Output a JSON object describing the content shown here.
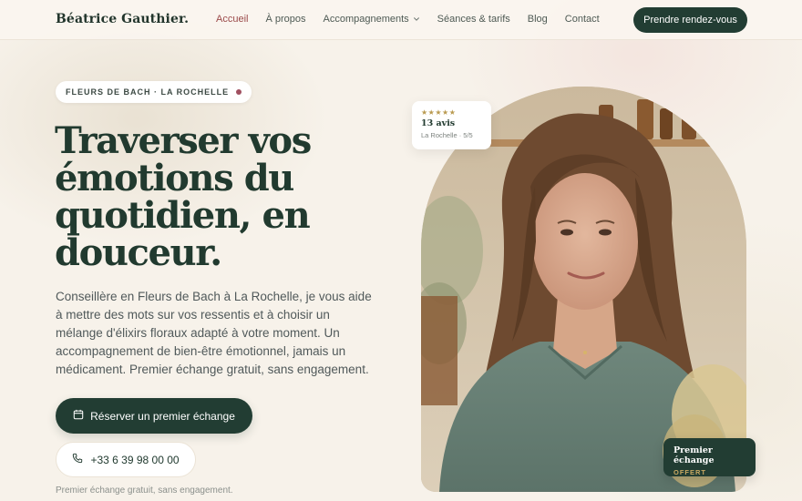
{
  "header": {
    "logo": "Béatrice Gauthier.",
    "nav": [
      {
        "label": "Accueil",
        "active": true
      },
      {
        "label": "À propos",
        "active": false
      },
      {
        "label": "Accompagnements",
        "active": false,
        "dropdown": true
      },
      {
        "label": "Séances & tarifs",
        "active": false
      },
      {
        "label": "Blog",
        "active": false
      },
      {
        "label": "Contact",
        "active": false
      }
    ],
    "cta": "Prendre rendez-vous"
  },
  "hero": {
    "badge": "FLEURS DE BACH · LA ROCHELLE",
    "headline": "Traverser vos émotions du quotidien, en douceur.",
    "subtext": "Conseillère en Fleurs de Bach à La Rochelle, je vous aide à mettre des mots sur vos ressentis et à choisir un mélange d'élixirs floraux adapté à votre moment. Un accompagnement de bien-être émotionnel, jamais un médicament. Premier échange gratuit, sans engagement.",
    "primary_button": "Réserver un premier échange",
    "phone_button": "+33 6 39 98 00 00",
    "note": "Premier échange gratuit, sans engagement."
  },
  "review_card": {
    "stars": "★★★★★",
    "count": "13 avis",
    "location": "La Rochelle · 5/5"
  },
  "offer_card": {
    "title": "Premier échange",
    "subtitle": "OFFERT"
  },
  "colors": {
    "accent_dark_green": "#223d33",
    "nav_active": "#9b4a4a",
    "background": "#f7f2ea",
    "gold": "#c8a861"
  },
  "icons": {
    "calendar": "calendar-icon",
    "phone": "phone-icon",
    "chevron": "chevron-down-icon"
  }
}
